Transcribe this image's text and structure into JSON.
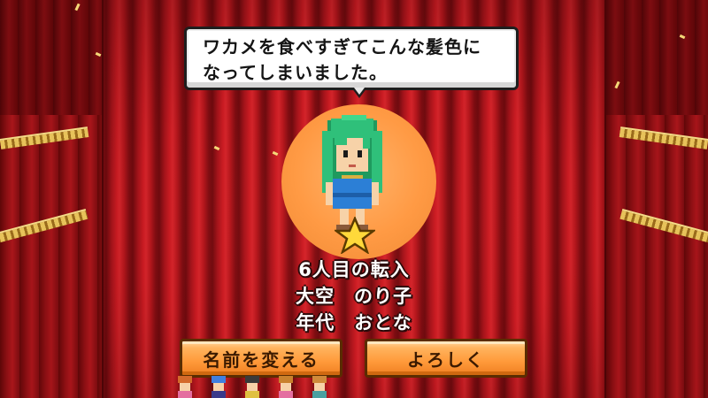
{
  "scene": {
    "speech": {
      "lines": [
        "ワカメを食べすぎてこんな髪色に",
        "なってしまいました。"
      ]
    },
    "portrait": {
      "hair_color": "#2fc07a",
      "halo_color": "#ff9a44",
      "icons": [
        "character-sprite",
        "star-icon"
      ]
    },
    "info": {
      "arrival": "6人目の転入",
      "name": "大空　のり子",
      "age_group": "年代　おとな"
    }
  },
  "buttons": {
    "rename_label": "名前を変える",
    "ok_label": "よろしく"
  },
  "residents": {
    "count_shown": 5,
    "hair_colors": [
      "#d46a2a",
      "#3f7fe0",
      "#3a3a3a",
      "#c9812d",
      "#d08a3a"
    ]
  },
  "colors": {
    "curtain": "#c91b22",
    "button": "#ff9a3a",
    "fringe": "#e7c25a"
  }
}
